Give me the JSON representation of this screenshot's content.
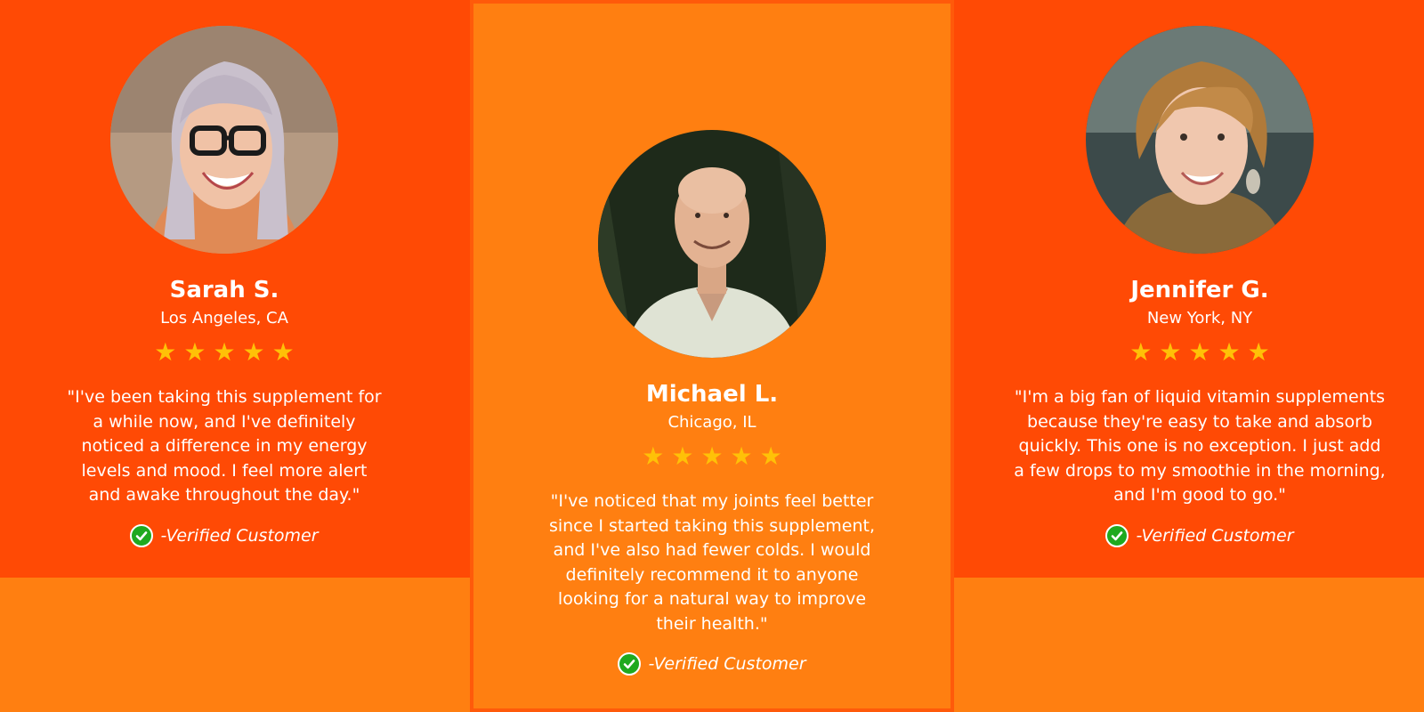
{
  "colors": {
    "panel_red": "#FF4A05",
    "panel_orange": "#FF7F11",
    "star": "#FFC107",
    "verified_check": "#1FA91F"
  },
  "testimonials": [
    {
      "name": "Sarah S.",
      "location": "Los Angeles, CA",
      "rating": 5,
      "quote_lines": [
        "\"I've been taking this supplement for",
        "a while now, and I've definitely",
        "noticed a difference in my energy",
        "levels and mood. I feel more alert",
        "and awake throughout the day.\""
      ],
      "verified_label": "-Verified Customer",
      "avatar_icon": "woman-with-glasses-photo"
    },
    {
      "name": "Michael L.",
      "location": "Chicago, IL",
      "rating": 5,
      "quote_lines": [
        "\"I've noticed that my joints feel better",
        "since I started taking this supplement,",
        "and I've also had fewer colds. I would",
        "definitely recommend it to anyone",
        "looking for a natural way to improve",
        "their health.\""
      ],
      "verified_label": "-Verified Customer",
      "avatar_icon": "bald-man-photo"
    },
    {
      "name": "Jennifer G.",
      "location": "New York, NY",
      "rating": 5,
      "quote_lines": [
        "\"I'm a big fan of liquid vitamin supplements",
        "because they're easy to take and absorb",
        "quickly. This one is no exception. I just add",
        "a few drops to my smoothie in the morning,",
        "and I'm good to go.\""
      ],
      "verified_label": "-Verified Customer",
      "avatar_icon": "smiling-woman-photo"
    }
  ]
}
